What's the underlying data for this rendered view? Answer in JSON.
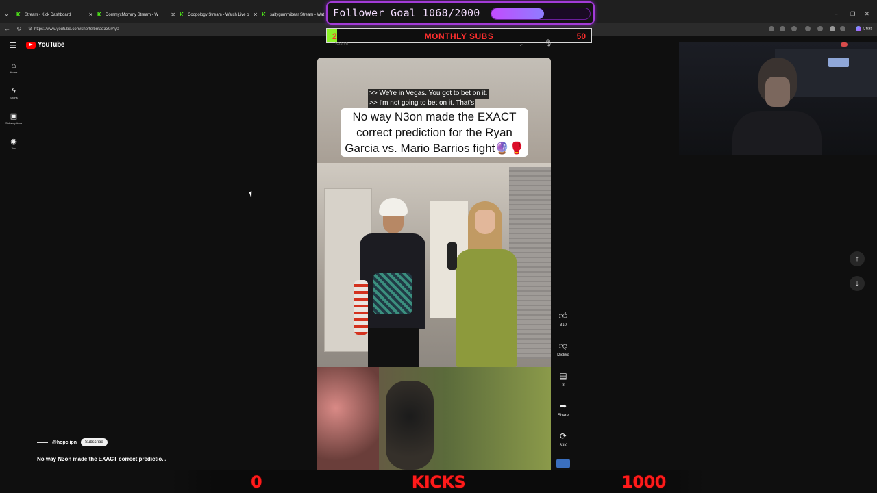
{
  "browser": {
    "tabs": [
      {
        "title": "Stream - Kick Dashboard"
      },
      {
        "title": "DommyxMommy Stream - W"
      },
      {
        "title": "Coopology Stream - Watch Live o"
      },
      {
        "title": "saltygummibear Stream - Wat"
      }
    ],
    "url": "https://www.youtube.com/shorts/bmaq339rAy0",
    "chat_label": "Chat"
  },
  "overlay": {
    "follower_goal_label": "Follower Goal 1068/2000",
    "follower_current": 1068,
    "follower_target": 2000,
    "subs_current": "2",
    "subs_label": "MONTHLY SUBS",
    "subs_target": "50",
    "subs_progress": 0.04,
    "kicks_current": "0",
    "kicks_label": "KICKS",
    "kicks_target": "1000"
  },
  "youtube": {
    "logo_text": "YouTube",
    "search_placeholder": "Search",
    "sidebar": [
      {
        "label": "Home",
        "icon": "home-icon"
      },
      {
        "label": "Shorts",
        "icon": "shorts-icon"
      },
      {
        "label": "Subscriptions",
        "icon": "subscriptions-icon"
      },
      {
        "label": "You",
        "icon": "account-icon"
      }
    ],
    "short": {
      "caption_line1": ">> We're in Vegas. You got to bet on it.",
      "caption_line2": ">> I'm not going to bet on it. That's",
      "overlay_title": "No way N3on made the EXACT correct prediction for the Ryan Garcia vs. Mario Barrios fight🔮🥊",
      "channel": "@hopclipn",
      "subscribe_label": "Subscribe",
      "title": "No way N3on made the EXACT correct predictio..."
    },
    "actions": [
      {
        "icon": "like-icon",
        "label": "310"
      },
      {
        "icon": "dislike-icon",
        "label": "Dislike"
      },
      {
        "icon": "comment-icon",
        "label": "8"
      },
      {
        "icon": "share-icon",
        "label": "Share"
      },
      {
        "icon": "remix-icon",
        "label": "33K"
      }
    ]
  }
}
